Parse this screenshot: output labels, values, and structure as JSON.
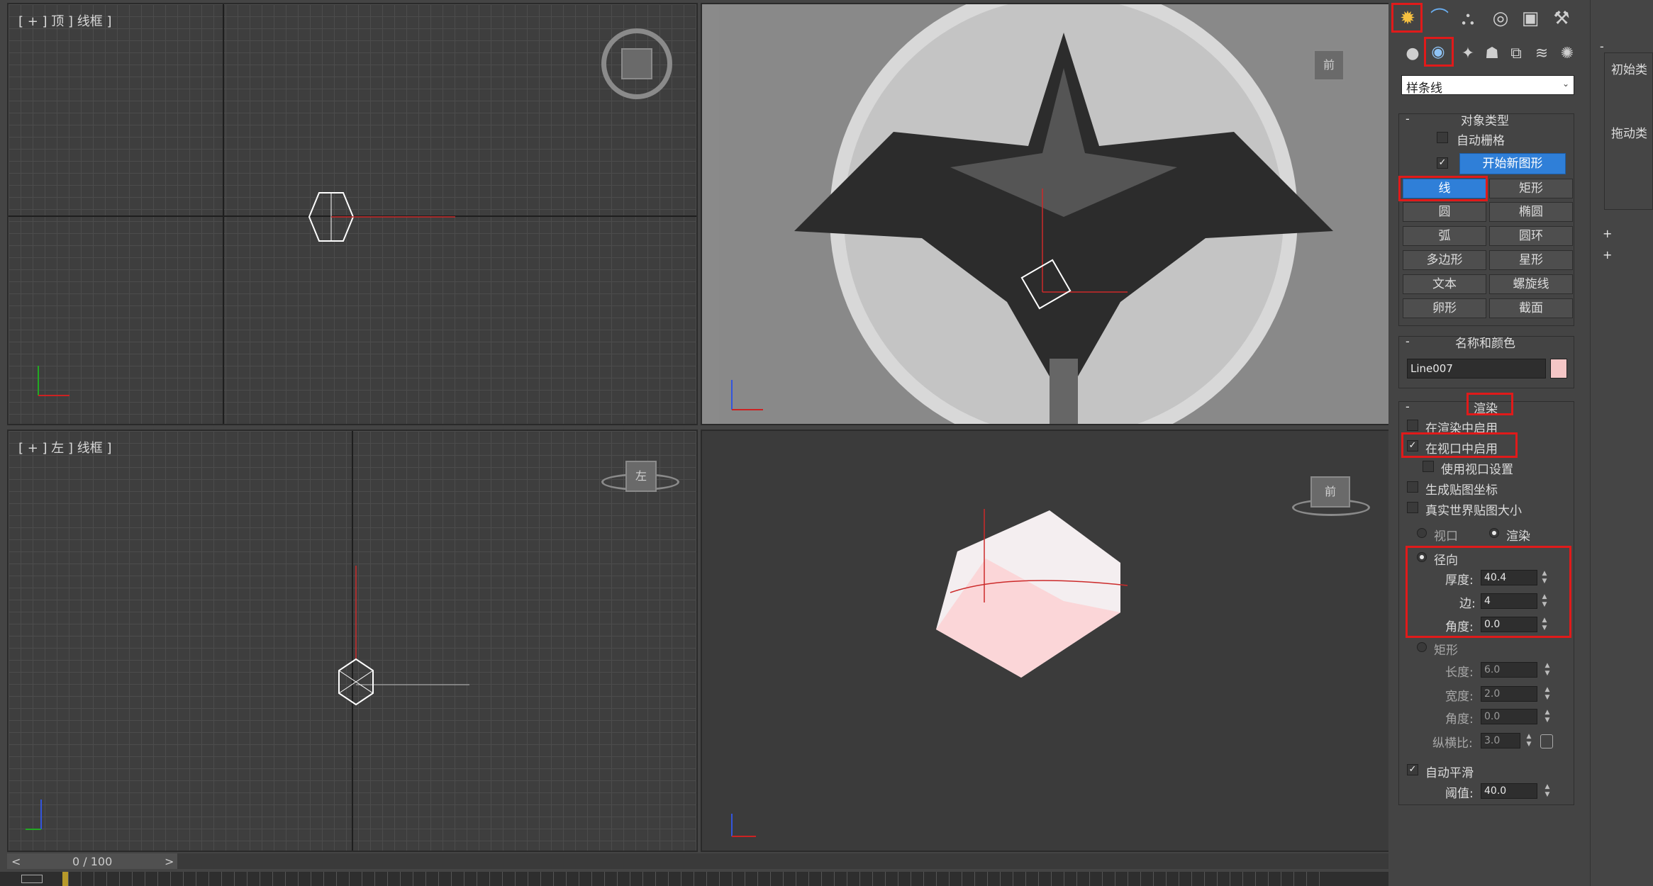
{
  "viewports": {
    "top": {
      "label": "[ + ] 顶 ] 线框 ]"
    },
    "front": {
      "gizmo": "前"
    },
    "left": {
      "label": "[ + ] 左 ] 线框 ]",
      "gizmo": "左"
    },
    "persp": {
      "gizmo": "前"
    }
  },
  "timeline": {
    "frame": "0 / 100",
    "prev": "<",
    "next": ">"
  },
  "command_panel": {
    "tabs": [
      "create-tab",
      "modify-tab",
      "hierarchy-tab",
      "motion-tab",
      "display-tab",
      "utilities-tab"
    ],
    "subtabs": [
      "geometry",
      "shapes",
      "lights",
      "cameras",
      "helpers",
      "spacewarps",
      "systems"
    ],
    "category_dropdown": "样条线",
    "object_type": {
      "title": "对象类型",
      "autogrid": "自动栅格",
      "start_new_shape": "开始新图形",
      "buttons": [
        "线",
        "矩形",
        "圆",
        "椭圆",
        "弧",
        "圆环",
        "多边形",
        "星形",
        "文本",
        "螺旋线",
        "卵形",
        "截面"
      ]
    },
    "name_color": {
      "title": "名称和颜色",
      "name": "Line007",
      "color": "#f5c6c6"
    },
    "rendering": {
      "title": "渲染",
      "enable_in_renderer": "在渲染中启用",
      "enable_in_viewport": "在视口中启用",
      "use_viewport_settings": "使用视口设置",
      "gen_mapping_coords": "生成贴图坐标",
      "real_world_map_size": "真实世界贴图大小",
      "mode_viewport": "视口",
      "mode_render": "渲染",
      "radial": "径向",
      "thickness_label": "厚度:",
      "thickness": "40.4",
      "sides_label": "边:",
      "sides": "4",
      "angle_label": "角度:",
      "angle": "0.0",
      "rectangular": "矩形",
      "length_label": "长度:",
      "length": "6.0",
      "width_label": "宽度:",
      "width": "2.0",
      "rect_angle_label": "角度:",
      "rect_angle": "0.0",
      "aspect_label": "纵横比:",
      "aspect": "3.0",
      "auto_smooth": "自动平滑",
      "threshold_label": "阈值:",
      "threshold": "40.0"
    }
  },
  "right_panel": {
    "initial_type": "初始类",
    "drag_type": "拖动类",
    "minus": "-",
    "plus1": "+",
    "plus2": "+"
  }
}
